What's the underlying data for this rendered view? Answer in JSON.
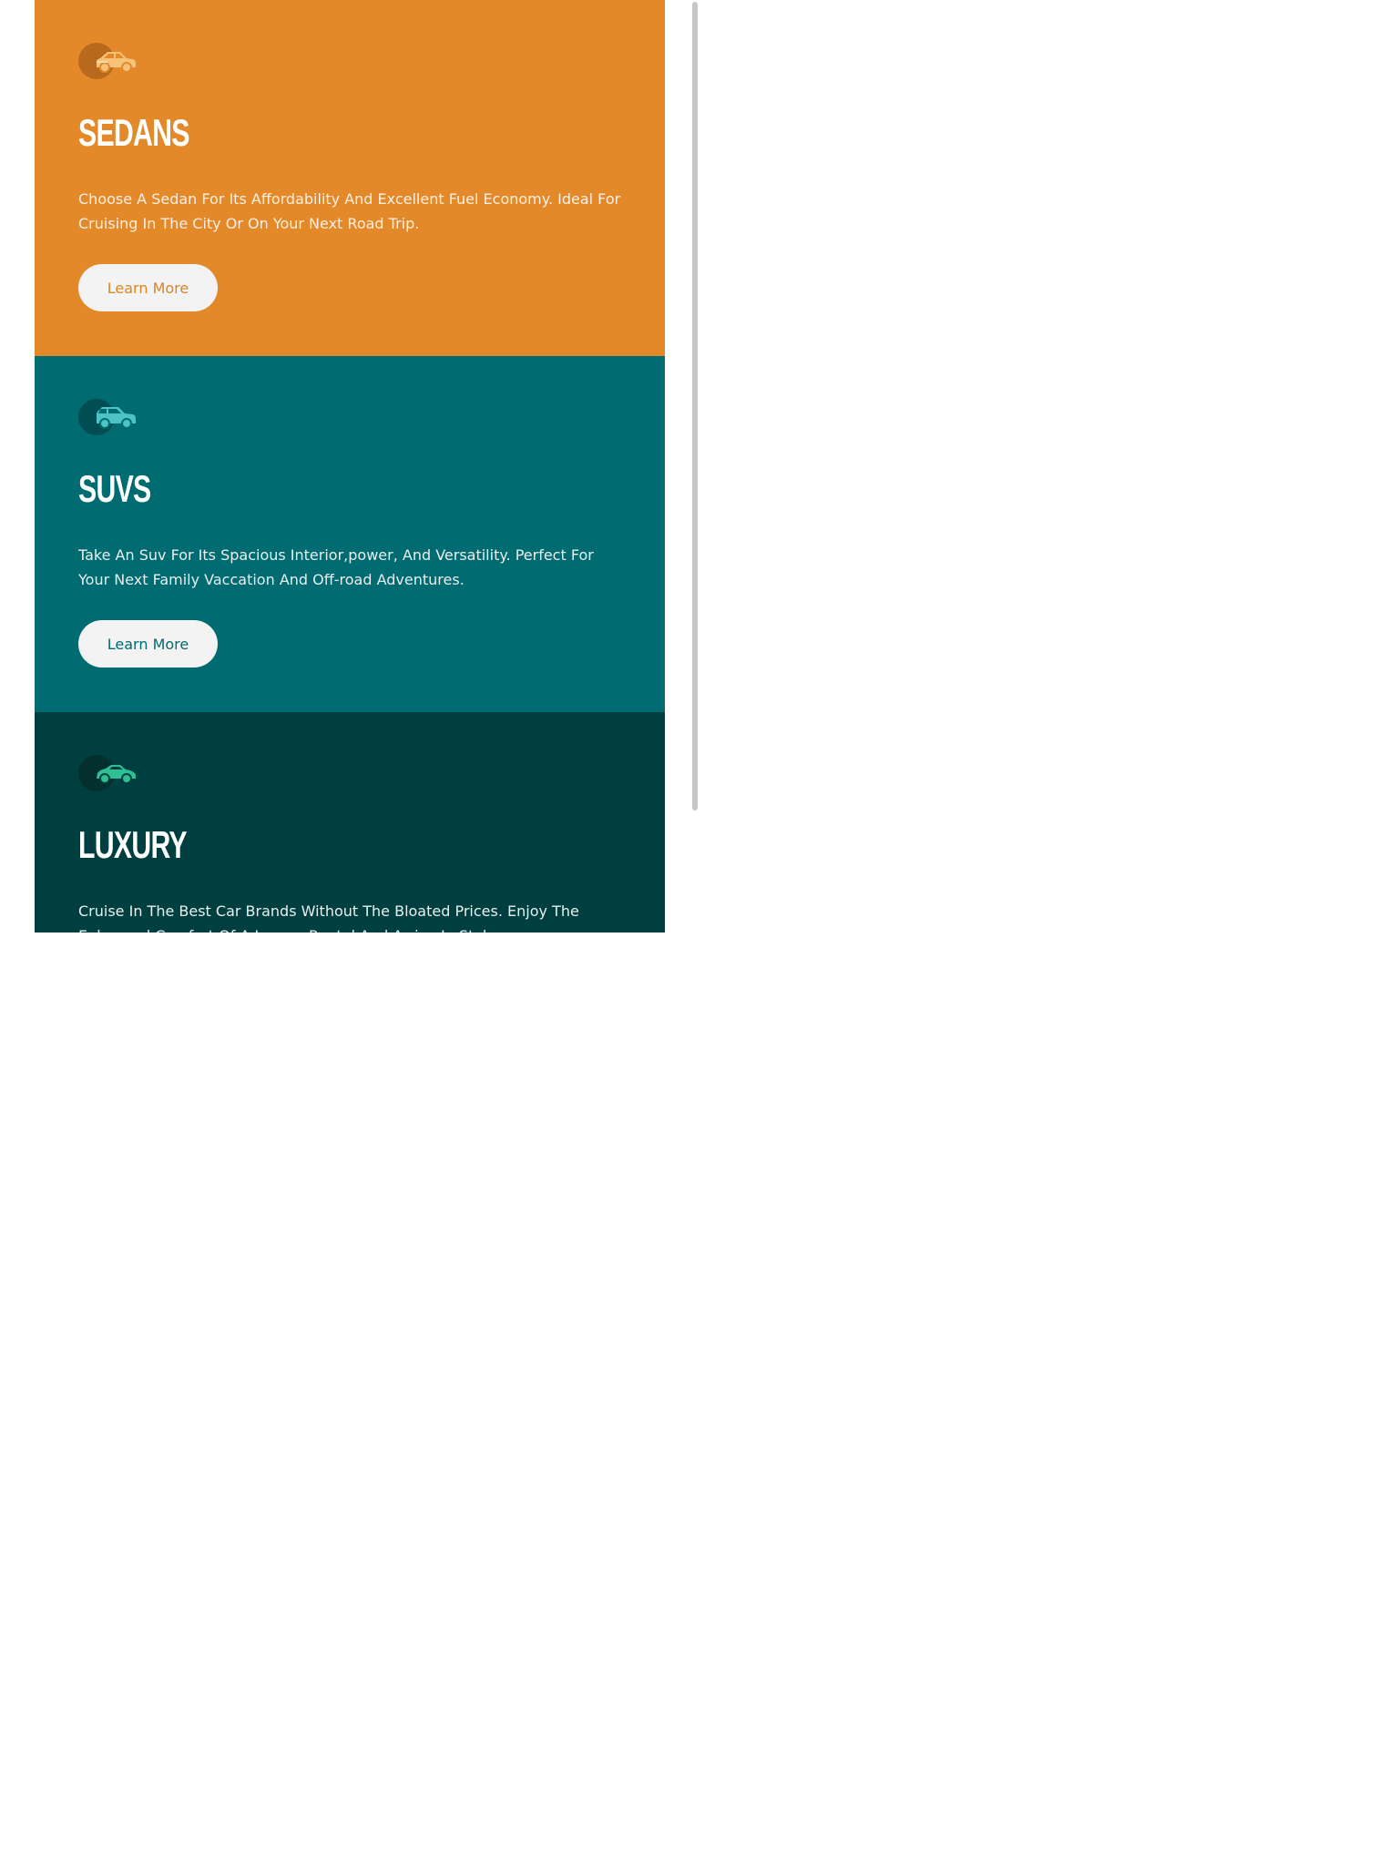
{
  "colors": {
    "sedans_bg": "#e3892a",
    "suvs_bg": "#006b70",
    "luxury_bg": "#003f40",
    "button_bg": "#f3f3f3",
    "sedans_icon": "#f6c27a",
    "suvs_icon": "#4cc3c7",
    "luxury_icon": "#2fbf92"
  },
  "cards": [
    {
      "icon": "sedan-car-icon",
      "title": "SEDANS",
      "description": "Choose A Sedan For Its Affordability And Excellent Fuel Economy. Ideal For Cruising In The City Or On Your Next Road Trip.",
      "button_label": "Learn More"
    },
    {
      "icon": "suv-car-icon",
      "title": "SUVS",
      "description": "Take An Suv For Its Spacious Interior,power, And Versatility. Perfect For Your Next Family Vaccation And Off-road Adventures.",
      "button_label": "Learn More"
    },
    {
      "icon": "luxury-car-icon",
      "title": "LUXURY",
      "description": "Cruise In The Best Car Brands Without The Bloated Prices. Enjoy The Enhanced Comfort Of A Luxury Rental And Arrive In Style."
    }
  ]
}
